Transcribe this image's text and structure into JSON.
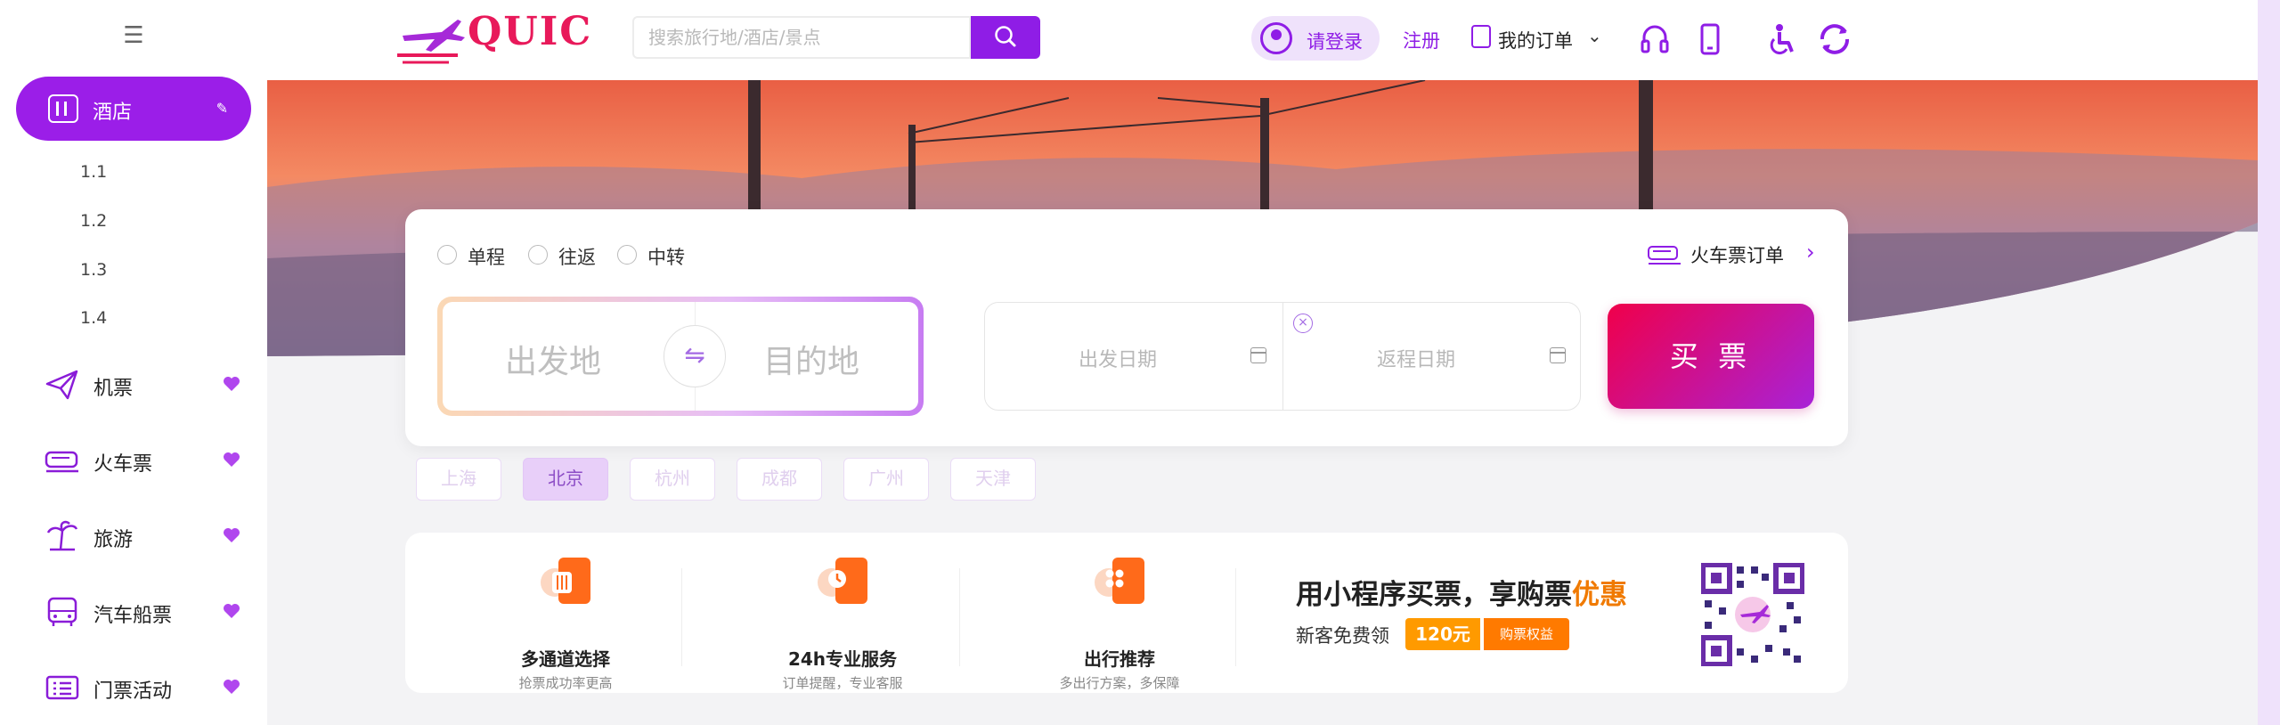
{
  "sidebar": {
    "active_item": "酒店",
    "sub_items": [
      "1.1",
      "1.2",
      "1.3",
      "1.4"
    ],
    "items": [
      {
        "label": "机票",
        "icon": "paper-plane-icon"
      },
      {
        "label": "火车票",
        "icon": "train-icon"
      },
      {
        "label": "旅游",
        "icon": "palm-tree-icon"
      },
      {
        "label": "汽车船票",
        "icon": "bus-icon"
      },
      {
        "label": "门票活动",
        "icon": "ticket-icon"
      }
    ]
  },
  "header": {
    "logo_text": "QUIC",
    "search_placeholder": "搜索旅行地/酒店/景点",
    "login": "请登录",
    "register": "注册",
    "orders": "我的订单"
  },
  "booking": {
    "trip_types": [
      "单程",
      "往返",
      "中转"
    ],
    "train_orders": "火车票订单",
    "from_placeholder": "出发地",
    "to_placeholder": "目的地",
    "depart_date_placeholder": "出发日期",
    "return_date_placeholder": "返程日期",
    "buy_label": "买 票"
  },
  "cities": [
    "上海",
    "北京",
    "杭州",
    "成都",
    "广州",
    "天津"
  ],
  "active_city": "北京",
  "features": [
    {
      "title": "多通道选择",
      "desc": "抢票成功率更高"
    },
    {
      "title": "24h专业服务",
      "desc": "订单提醒，专业客服"
    },
    {
      "title": "出行推荐",
      "desc": "多出行方案，多保障"
    }
  ],
  "promo": {
    "title_main": "用小程序买票，享购票",
    "title_highlight": "优惠",
    "subtitle": "新客免费领",
    "coupon_amount": "120元",
    "coupon_tag": "购票权益"
  },
  "colors": {
    "brand": "#8f1de6",
    "buy_gradient_start": "#f0004a",
    "buy_gradient_end": "#a822d8",
    "promo_highlight": "#f07a00"
  }
}
